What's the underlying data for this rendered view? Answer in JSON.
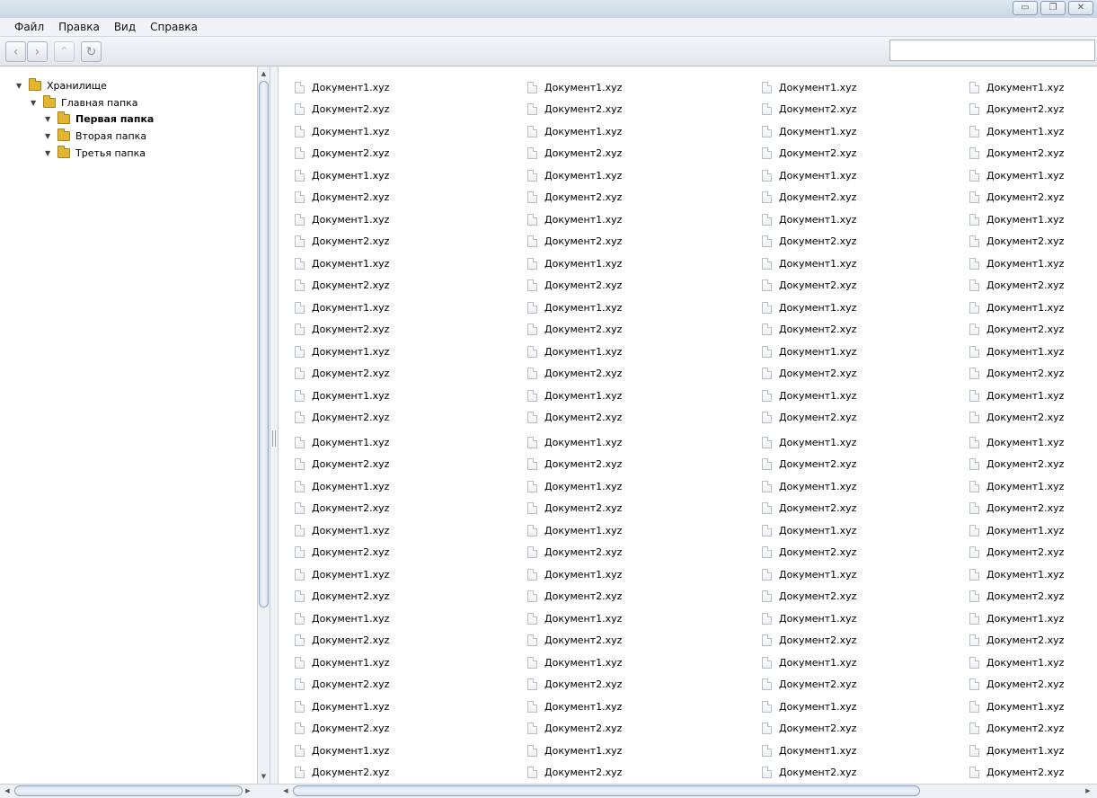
{
  "window": {
    "buttons": {
      "minimize": "▭",
      "restore": "❐",
      "close": "✕"
    }
  },
  "menu": [
    "Файл",
    "Правка",
    "Вид",
    "Справка"
  ],
  "toolbar": {
    "back": "‹",
    "forward": "›",
    "up": "⌃",
    "refresh": "↻",
    "search_value": ""
  },
  "tree": [
    {
      "label": "Хранилище",
      "arrow": "▼",
      "bold": false
    },
    {
      "label": "Главная папка",
      "arrow": "▼",
      "bold": false
    },
    {
      "label": "Первая папка",
      "arrow": "▼",
      "bold": true
    },
    {
      "label": "Вторая папка",
      "arrow": "▼",
      "bold": false
    },
    {
      "label": "Третья папка",
      "arrow": "▼",
      "bold": false
    }
  ],
  "files": {
    "names": [
      "Документ1.xyz",
      "Документ2.xyz"
    ],
    "columns": 4,
    "rows": 32
  },
  "scroll": {
    "up": "▲",
    "down": "▼",
    "left": "◀",
    "right": "▶"
  }
}
